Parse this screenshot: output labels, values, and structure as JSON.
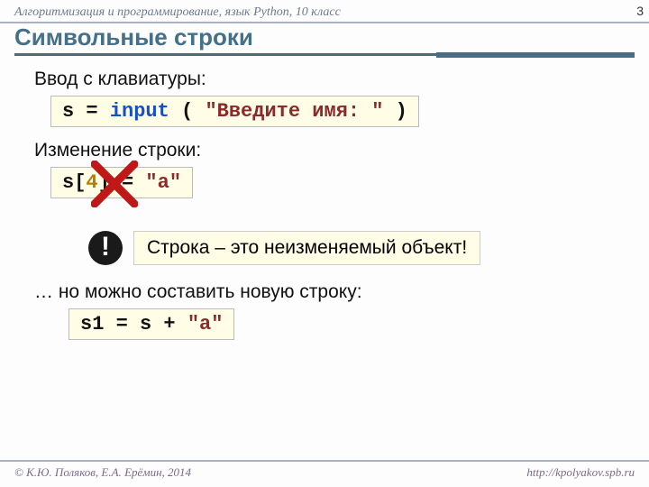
{
  "header": {
    "breadcrumb": "Алгоритмизация и программирование, язык Python, 10 класс",
    "page_number": "3",
    "title": "Символьные строки"
  },
  "section1": {
    "label": "Ввод с клавиатуры:",
    "code": {
      "var": "s",
      "eq": " = ",
      "fn": "input",
      "open": " ( ",
      "str": "\"Введите имя: \"",
      "close": " )"
    }
  },
  "section2": {
    "label": "Изменение строки:",
    "code": {
      "var": "s",
      "lb": "[",
      "idx": "4",
      "rb": "]",
      "eq": " = ",
      "str": "\"a\""
    }
  },
  "note": {
    "bang": "!",
    "text": "Строка – это неизменяемый объект!"
  },
  "section3": {
    "label": "… но можно составить новую строку:",
    "code": {
      "lhs": "s1",
      "eq": " = ",
      "rhs": "s + ",
      "str": "\"a\""
    }
  },
  "footer": {
    "left": "© К.Ю. Поляков, Е.А. Ерёмин, 2014",
    "right": "http://kpolyakov.spb.ru"
  }
}
